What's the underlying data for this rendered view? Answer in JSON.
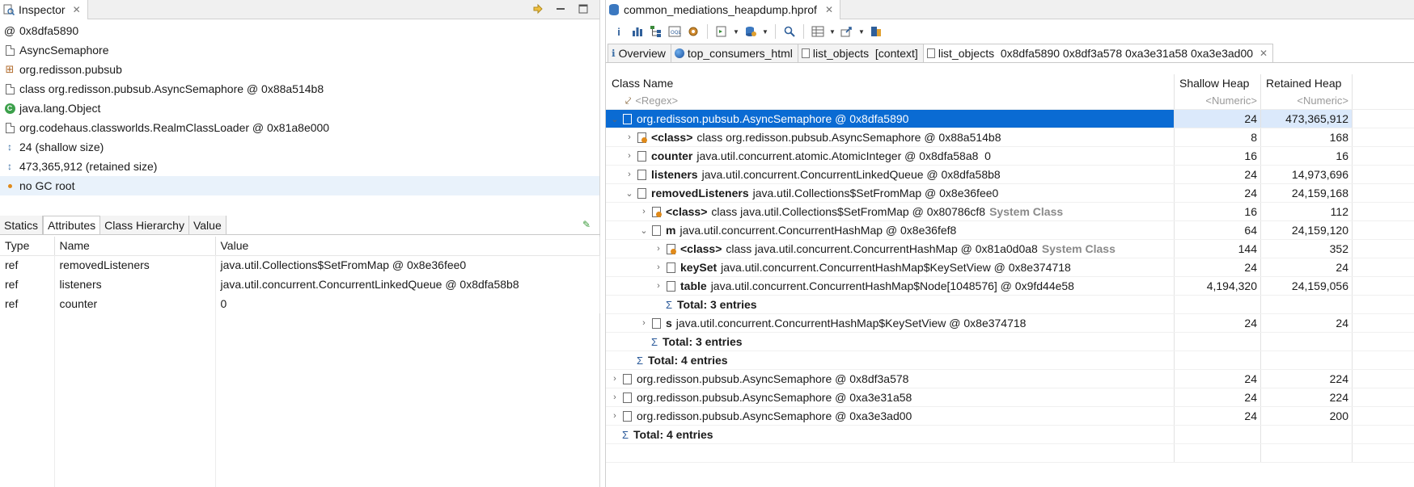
{
  "inspector": {
    "tab_title": "Inspector",
    "rows": [
      {
        "icon": "at-icon",
        "text": "0x8dfa5890"
      },
      {
        "icon": "class-icon",
        "text": "AsyncSemaphore"
      },
      {
        "icon": "package-icon",
        "text": "org.redisson.pubsub"
      },
      {
        "icon": "class-file-icon",
        "text": "class org.redisson.pubsub.AsyncSemaphore @ 0x88a514b8"
      },
      {
        "icon": "object-icon",
        "text": "java.lang.Object"
      },
      {
        "icon": "class-file-icon",
        "text": "org.codehaus.classworlds.RealmClassLoader @ 0x81a8e000"
      },
      {
        "icon": "size-icon",
        "text": "24 (shallow size)"
      },
      {
        "icon": "size-icon",
        "text": "473,365,912 (retained size)"
      },
      {
        "icon": "gc-root-icon",
        "text": "no GC root"
      }
    ],
    "attr_tabs": [
      "Statics",
      "Attributes",
      "Class Hierarchy",
      "Value"
    ],
    "active_attr_tab": "Attributes",
    "attr_columns": [
      "Type",
      "Name",
      "Value"
    ],
    "attributes": [
      {
        "type": "ref",
        "name": "removedListeners",
        "value": "java.util.Collections$SetFromMap @ 0x8e36fee0"
      },
      {
        "type": "ref",
        "name": "listeners",
        "value": "java.util.concurrent.ConcurrentLinkedQueue @ 0x8dfa58b8"
      },
      {
        "type": "ref",
        "name": "counter",
        "value": "0"
      }
    ]
  },
  "editor": {
    "file_tab": "common_mediations_heapdump.hprof",
    "sub_tabs": [
      {
        "icon": "info-icon",
        "label": "Overview"
      },
      {
        "icon": "globe-icon",
        "label": "top_consumers_html"
      },
      {
        "icon": "doc-icon",
        "label": "list_objects  [context]"
      },
      {
        "icon": "doc-icon",
        "label": "list_objects  0x8dfa5890 0x8df3a578 0xa3e31a58 0xa3e3ad00"
      }
    ],
    "columns": {
      "class_name": "Class Name",
      "shallow": "Shallow Heap",
      "retained": "Retained Heap"
    },
    "filter": {
      "class_name": "<Regex>",
      "shallow": "<Numeric>",
      "retained": "<Numeric>"
    },
    "rows": [
      {
        "indent": 0,
        "twisty": "open",
        "field": "",
        "text": "org.redisson.pubsub.AsyncSemaphore @ 0x8dfa5890",
        "sys": "",
        "shallow": "24",
        "retained": "473,365,912",
        "selected": true
      },
      {
        "indent": 1,
        "twisty": "closed",
        "field": "<class>",
        "text": "class org.redisson.pubsub.AsyncSemaphore @ 0x88a514b8",
        "sys": "",
        "shallow": "8",
        "retained": "168"
      },
      {
        "indent": 1,
        "twisty": "closed",
        "field": "counter",
        "text": "java.util.concurrent.atomic.AtomicInteger @ 0x8dfa58a8  0",
        "sys": "",
        "shallow": "16",
        "retained": "16"
      },
      {
        "indent": 1,
        "twisty": "closed",
        "field": "listeners",
        "text": "java.util.concurrent.ConcurrentLinkedQueue @ 0x8dfa58b8",
        "sys": "",
        "shallow": "24",
        "retained": "14,973,696"
      },
      {
        "indent": 1,
        "twisty": "open",
        "field": "removedListeners",
        "text": "java.util.Collections$SetFromMap @ 0x8e36fee0",
        "sys": "",
        "shallow": "24",
        "retained": "24,159,168"
      },
      {
        "indent": 2,
        "twisty": "closed",
        "field": "<class>",
        "text": "class java.util.Collections$SetFromMap @ 0x80786cf8",
        "sys": "System Class",
        "shallow": "16",
        "retained": "112"
      },
      {
        "indent": 2,
        "twisty": "open",
        "field": "m",
        "text": "java.util.concurrent.ConcurrentHashMap @ 0x8e36fef8",
        "sys": "",
        "shallow": "64",
        "retained": "24,159,120"
      },
      {
        "indent": 3,
        "twisty": "closed",
        "field": "<class>",
        "text": "class java.util.concurrent.ConcurrentHashMap @ 0x81a0d0a8",
        "sys": "System Class",
        "shallow": "144",
        "retained": "352"
      },
      {
        "indent": 3,
        "twisty": "closed",
        "field": "keySet",
        "text": "java.util.concurrent.ConcurrentHashMap$KeySetView @ 0x8e374718",
        "sys": "",
        "shallow": "24",
        "retained": "24"
      },
      {
        "indent": 3,
        "twisty": "closed",
        "field": "table",
        "text": "java.util.concurrent.ConcurrentHashMap$Node[1048576] @ 0x9fd44e58",
        "sys": "",
        "shallow": "4,194,320",
        "retained": "24,159,056"
      },
      {
        "indent": 3,
        "twisty": "total",
        "field": "",
        "text": "Total: 3 entries",
        "sys": "",
        "shallow": "",
        "retained": ""
      },
      {
        "indent": 2,
        "twisty": "closed",
        "field": "s",
        "text": "java.util.concurrent.ConcurrentHashMap$KeySetView @ 0x8e374718",
        "sys": "",
        "shallow": "24",
        "retained": "24"
      },
      {
        "indent": 2,
        "twisty": "total",
        "field": "",
        "text": "Total: 3 entries",
        "sys": "",
        "shallow": "",
        "retained": ""
      },
      {
        "indent": 1,
        "twisty": "total",
        "field": "",
        "text": "Total: 4 entries",
        "sys": "",
        "shallow": "",
        "retained": ""
      },
      {
        "indent": 0,
        "twisty": "closed",
        "field": "",
        "text": "org.redisson.pubsub.AsyncSemaphore @ 0x8df3a578",
        "sys": "",
        "shallow": "24",
        "retained": "224"
      },
      {
        "indent": 0,
        "twisty": "closed",
        "field": "",
        "text": "org.redisson.pubsub.AsyncSemaphore @ 0xa3e31a58",
        "sys": "",
        "shallow": "24",
        "retained": "224"
      },
      {
        "indent": 0,
        "twisty": "closed",
        "field": "",
        "text": "org.redisson.pubsub.AsyncSemaphore @ 0xa3e3ad00",
        "sys": "",
        "shallow": "24",
        "retained": "200"
      },
      {
        "indent": 0,
        "twisty": "total",
        "field": "",
        "text": "Total: 4 entries",
        "sys": "",
        "shallow": "",
        "retained": ""
      }
    ]
  },
  "colors": {
    "selection": "#0a6bd3",
    "selection_light": "#dbe9fb",
    "gc_root_row": "#e9f2fb",
    "system_class_text": "#8a8a8a"
  }
}
